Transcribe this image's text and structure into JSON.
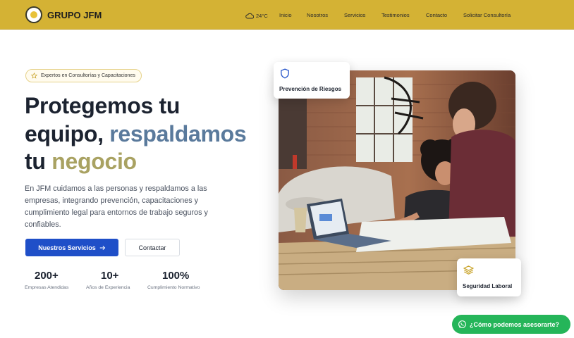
{
  "header": {
    "brand": "GRUPO JFM",
    "weather": {
      "icon": "cloud-icon",
      "temperature": "24°C"
    },
    "nav": [
      "Inicio",
      "Nosotros",
      "Servicios",
      "Testimonios",
      "Contacto",
      "Solicitar Consultoría"
    ]
  },
  "hero": {
    "badge": "Expertos en Consultorías y Capacitaciones",
    "title": {
      "line1": "Protegemos tu",
      "line2_a": "equipo, ",
      "line2_b": "respaldamos",
      "line3_a": "tu ",
      "line3_b": "negocio"
    },
    "description": "En JFM cuidamos a las personas y respaldamos a las empresas, integrando prevención, capacitaciones y cumplimiento legal para entornos de trabajo seguros y confiables.",
    "primary_button": "Nuestros Servicios",
    "secondary_button": "Contactar",
    "stats": [
      {
        "value": "200+",
        "label": "Empresas Atendidas"
      },
      {
        "value": "10+",
        "label": "Años de Experiencia"
      },
      {
        "value": "100%",
        "label": "Cumplimiento Normativo"
      }
    ]
  },
  "cards": {
    "top": {
      "title": "Prevención de Riesgos",
      "icon": "shield-icon"
    },
    "bottom": {
      "title": "Seguridad Laboral",
      "icon": "layers-icon"
    }
  },
  "whatsapp": {
    "label": "¿Cómo podemos asesorarte?",
    "icon": "whatsapp-icon"
  },
  "colors": {
    "header": "#d4b234",
    "primary": "#1f4fc8",
    "title_blue": "#5a7a9c",
    "title_olive": "#a9a262",
    "whatsapp": "#25b559"
  }
}
